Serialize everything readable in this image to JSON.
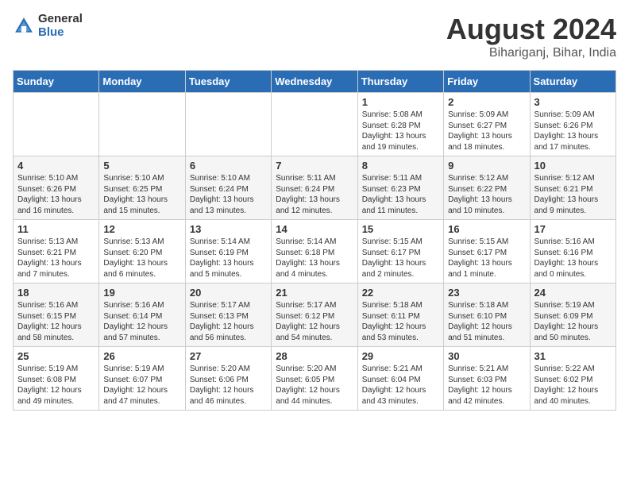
{
  "logo": {
    "general": "General",
    "blue": "Blue"
  },
  "title": {
    "month_year": "August 2024",
    "location": "Bihariganj, Bihar, India"
  },
  "weekdays": [
    "Sunday",
    "Monday",
    "Tuesday",
    "Wednesday",
    "Thursday",
    "Friday",
    "Saturday"
  ],
  "weeks": [
    [
      {
        "day": "",
        "info": ""
      },
      {
        "day": "",
        "info": ""
      },
      {
        "day": "",
        "info": ""
      },
      {
        "day": "",
        "info": ""
      },
      {
        "day": "1",
        "info": "Sunrise: 5:08 AM\nSunset: 6:28 PM\nDaylight: 13 hours\nand 19 minutes."
      },
      {
        "day": "2",
        "info": "Sunrise: 5:09 AM\nSunset: 6:27 PM\nDaylight: 13 hours\nand 18 minutes."
      },
      {
        "day": "3",
        "info": "Sunrise: 5:09 AM\nSunset: 6:26 PM\nDaylight: 13 hours\nand 17 minutes."
      }
    ],
    [
      {
        "day": "4",
        "info": "Sunrise: 5:10 AM\nSunset: 6:26 PM\nDaylight: 13 hours\nand 16 minutes."
      },
      {
        "day": "5",
        "info": "Sunrise: 5:10 AM\nSunset: 6:25 PM\nDaylight: 13 hours\nand 15 minutes."
      },
      {
        "day": "6",
        "info": "Sunrise: 5:10 AM\nSunset: 6:24 PM\nDaylight: 13 hours\nand 13 minutes."
      },
      {
        "day": "7",
        "info": "Sunrise: 5:11 AM\nSunset: 6:24 PM\nDaylight: 13 hours\nand 12 minutes."
      },
      {
        "day": "8",
        "info": "Sunrise: 5:11 AM\nSunset: 6:23 PM\nDaylight: 13 hours\nand 11 minutes."
      },
      {
        "day": "9",
        "info": "Sunrise: 5:12 AM\nSunset: 6:22 PM\nDaylight: 13 hours\nand 10 minutes."
      },
      {
        "day": "10",
        "info": "Sunrise: 5:12 AM\nSunset: 6:21 PM\nDaylight: 13 hours\nand 9 minutes."
      }
    ],
    [
      {
        "day": "11",
        "info": "Sunrise: 5:13 AM\nSunset: 6:21 PM\nDaylight: 13 hours\nand 7 minutes."
      },
      {
        "day": "12",
        "info": "Sunrise: 5:13 AM\nSunset: 6:20 PM\nDaylight: 13 hours\nand 6 minutes."
      },
      {
        "day": "13",
        "info": "Sunrise: 5:14 AM\nSunset: 6:19 PM\nDaylight: 13 hours\nand 5 minutes."
      },
      {
        "day": "14",
        "info": "Sunrise: 5:14 AM\nSunset: 6:18 PM\nDaylight: 13 hours\nand 4 minutes."
      },
      {
        "day": "15",
        "info": "Sunrise: 5:15 AM\nSunset: 6:17 PM\nDaylight: 13 hours\nand 2 minutes."
      },
      {
        "day": "16",
        "info": "Sunrise: 5:15 AM\nSunset: 6:17 PM\nDaylight: 13 hours\nand 1 minute."
      },
      {
        "day": "17",
        "info": "Sunrise: 5:16 AM\nSunset: 6:16 PM\nDaylight: 13 hours\nand 0 minutes."
      }
    ],
    [
      {
        "day": "18",
        "info": "Sunrise: 5:16 AM\nSunset: 6:15 PM\nDaylight: 12 hours\nand 58 minutes."
      },
      {
        "day": "19",
        "info": "Sunrise: 5:16 AM\nSunset: 6:14 PM\nDaylight: 12 hours\nand 57 minutes."
      },
      {
        "day": "20",
        "info": "Sunrise: 5:17 AM\nSunset: 6:13 PM\nDaylight: 12 hours\nand 56 minutes."
      },
      {
        "day": "21",
        "info": "Sunrise: 5:17 AM\nSunset: 6:12 PM\nDaylight: 12 hours\nand 54 minutes."
      },
      {
        "day": "22",
        "info": "Sunrise: 5:18 AM\nSunset: 6:11 PM\nDaylight: 12 hours\nand 53 minutes."
      },
      {
        "day": "23",
        "info": "Sunrise: 5:18 AM\nSunset: 6:10 PM\nDaylight: 12 hours\nand 51 minutes."
      },
      {
        "day": "24",
        "info": "Sunrise: 5:19 AM\nSunset: 6:09 PM\nDaylight: 12 hours\nand 50 minutes."
      }
    ],
    [
      {
        "day": "25",
        "info": "Sunrise: 5:19 AM\nSunset: 6:08 PM\nDaylight: 12 hours\nand 49 minutes."
      },
      {
        "day": "26",
        "info": "Sunrise: 5:19 AM\nSunset: 6:07 PM\nDaylight: 12 hours\nand 47 minutes."
      },
      {
        "day": "27",
        "info": "Sunrise: 5:20 AM\nSunset: 6:06 PM\nDaylight: 12 hours\nand 46 minutes."
      },
      {
        "day": "28",
        "info": "Sunrise: 5:20 AM\nSunset: 6:05 PM\nDaylight: 12 hours\nand 44 minutes."
      },
      {
        "day": "29",
        "info": "Sunrise: 5:21 AM\nSunset: 6:04 PM\nDaylight: 12 hours\nand 43 minutes."
      },
      {
        "day": "30",
        "info": "Sunrise: 5:21 AM\nSunset: 6:03 PM\nDaylight: 12 hours\nand 42 minutes."
      },
      {
        "day": "31",
        "info": "Sunrise: 5:22 AM\nSunset: 6:02 PM\nDaylight: 12 hours\nand 40 minutes."
      }
    ]
  ]
}
